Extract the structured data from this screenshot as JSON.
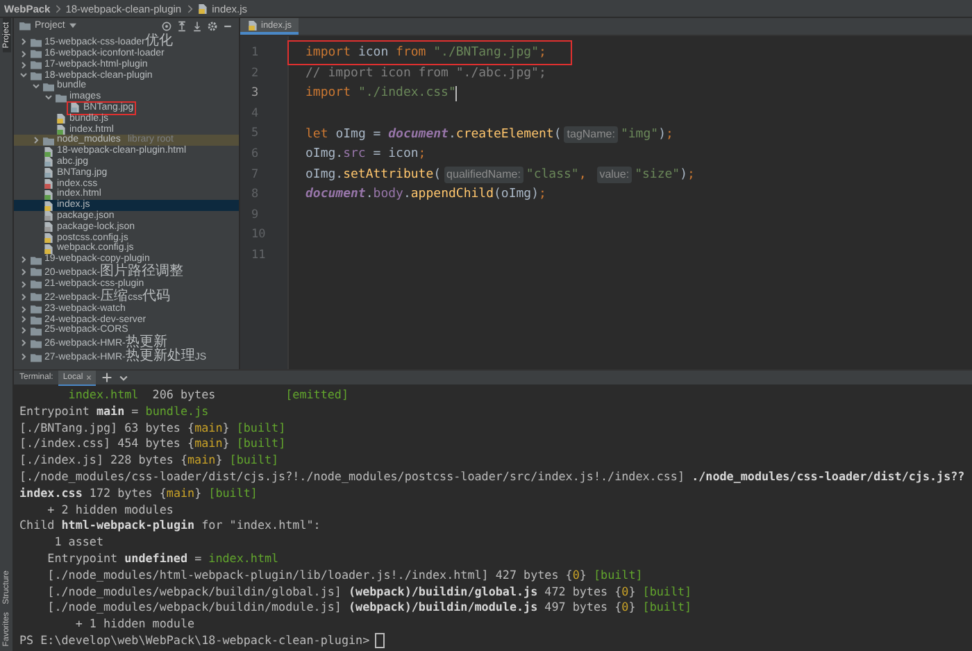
{
  "breadcrumbs": [
    {
      "label": "WebPack",
      "kind": "folder"
    },
    {
      "label": "18-webpack-clean-plugin",
      "kind": "folder"
    },
    {
      "label": "index.js",
      "kind": "js"
    }
  ],
  "tool_strip": [
    {
      "label": "Project",
      "selected": true
    },
    {
      "label": "Structure",
      "selected": false
    },
    {
      "label": "Favorites",
      "selected": false
    }
  ],
  "project_panel": {
    "title": "Project",
    "tree": [
      {
        "name": "15-webpack-css-loader优化",
        "kind": "folder",
        "expanded": false,
        "selected": false
      },
      {
        "name": "16-webpack-iconfont-loader",
        "kind": "folder",
        "expanded": false,
        "selected": false
      },
      {
        "name": "17-webpack-html-plugin",
        "kind": "folder",
        "expanded": false,
        "selected": false
      },
      {
        "name": "18-webpack-clean-plugin",
        "kind": "folder",
        "expanded": true,
        "selected": false,
        "children": [
          {
            "name": "bundle",
            "kind": "folder",
            "expanded": true,
            "selected": false,
            "children": [
              {
                "name": "images",
                "kind": "folder",
                "expanded": true,
                "selected": false,
                "children": [
                  {
                    "name": "BNTang.jpg",
                    "kind": "image",
                    "selected": false,
                    "boxed": true
                  }
                ]
              },
              {
                "name": "bundle.js",
                "kind": "js",
                "selected": false
              },
              {
                "name": "index.html",
                "kind": "html",
                "selected": false
              }
            ]
          },
          {
            "name": "node_modules",
            "note": "library root",
            "kind": "folder",
            "expanded": false,
            "selected": false,
            "library": true
          },
          {
            "name": "18-webpack-clean-plugin.html",
            "kind": "html",
            "selected": false
          },
          {
            "name": "abc.jpg",
            "kind": "image",
            "selected": false
          },
          {
            "name": "BNTang.jpg",
            "kind": "image",
            "selected": false
          },
          {
            "name": "index.css",
            "kind": "css",
            "selected": false
          },
          {
            "name": "index.html",
            "kind": "html",
            "selected": false
          },
          {
            "name": "index.js",
            "kind": "js",
            "selected": true
          },
          {
            "name": "package.json",
            "kind": "json",
            "selected": false
          },
          {
            "name": "package-lock.json",
            "kind": "json",
            "selected": false
          },
          {
            "name": "postcss.config.js",
            "kind": "js",
            "selected": false
          },
          {
            "name": "webpack.config.js",
            "kind": "js",
            "selected": false
          }
        ]
      },
      {
        "name": "19-webpack-copy-plugin",
        "kind": "folder",
        "expanded": false,
        "selected": false
      },
      {
        "name": "20-webpack-图片路径调整",
        "kind": "folder",
        "expanded": false,
        "selected": false
      },
      {
        "name": "21-webpack-css-plugin",
        "kind": "folder",
        "expanded": false,
        "selected": false
      },
      {
        "name": "22-webpack-压缩css代码",
        "kind": "folder",
        "expanded": false,
        "selected": false
      },
      {
        "name": "23-webpack-watch",
        "kind": "folder",
        "expanded": false,
        "selected": false
      },
      {
        "name": "24-webpack-dev-server",
        "kind": "folder",
        "expanded": false,
        "selected": false
      },
      {
        "name": "25-webpack-CORS",
        "kind": "folder",
        "expanded": false,
        "selected": false
      },
      {
        "name": "26-webpack-HMR-热更新",
        "kind": "folder",
        "expanded": false,
        "selected": false
      },
      {
        "name": "27-webpack-HMR-热更新处理JS",
        "kind": "folder",
        "expanded": false,
        "selected": false
      }
    ]
  },
  "editor": {
    "tab": "index.js",
    "lines": [
      {
        "number": "1",
        "boxed": true,
        "current": false,
        "tokens": [
          {
            "kind": "kw",
            "text": "import "
          },
          {
            "kind": "id",
            "text": "icon "
          },
          {
            "kind": "kw",
            "text": "from "
          },
          {
            "kind": "str",
            "text": "\"./BNTang.jpg\""
          },
          {
            "kind": "kw",
            "text": ";"
          }
        ]
      },
      {
        "number": "2",
        "boxed": false,
        "current": false,
        "tokens": [
          {
            "kind": "cmt",
            "text": "// import icon from \"./abc.jpg\";"
          }
        ]
      },
      {
        "number": "3",
        "boxed": false,
        "current": true,
        "tokens": [
          {
            "kind": "kw",
            "text": "import "
          },
          {
            "kind": "str",
            "text": "\"./index.css\""
          }
        ]
      },
      {
        "number": "4",
        "boxed": false,
        "current": false
      },
      {
        "number": "5",
        "boxed": false,
        "current": false,
        "tokens": [
          {
            "kind": "kw",
            "text": "let "
          },
          {
            "kind": "id",
            "text": "oImg = "
          },
          {
            "kind": "glob",
            "text": "document"
          },
          {
            "kind": "id",
            "text": "."
          },
          {
            "kind": "fn",
            "text": "createElement"
          },
          {
            "kind": "id",
            "text": "("
          },
          {
            "kind": "hint",
            "text": "tagName:"
          },
          {
            "kind": "str",
            "text": "\"img\""
          },
          {
            "kind": "id",
            "text": ")"
          },
          {
            "kind": "kw",
            "text": ";"
          }
        ]
      },
      {
        "number": "6",
        "boxed": false,
        "current": false,
        "tokens": [
          {
            "kind": "id",
            "text": "oImg."
          },
          {
            "kind": "field",
            "text": "src"
          },
          {
            "kind": "id",
            "text": " = icon"
          },
          {
            "kind": "kw",
            "text": ";"
          }
        ]
      },
      {
        "number": "7",
        "boxed": false,
        "current": false,
        "tokens": [
          {
            "kind": "id",
            "text": "oImg."
          },
          {
            "kind": "fn",
            "text": "setAttribute"
          },
          {
            "kind": "id",
            "text": "("
          },
          {
            "kind": "hint",
            "text": "qualifiedName:"
          },
          {
            "kind": "str",
            "text": "\"class\""
          },
          {
            "kind": "kw",
            "text": ", "
          },
          {
            "kind": "hint",
            "text": "value:"
          },
          {
            "kind": "str",
            "text": "\"size\""
          },
          {
            "kind": "id",
            "text": ")"
          },
          {
            "kind": "kw",
            "text": ";"
          }
        ]
      },
      {
        "number": "8",
        "boxed": false,
        "current": false,
        "tokens": [
          {
            "kind": "glob",
            "text": "document"
          },
          {
            "kind": "id",
            "text": "."
          },
          {
            "kind": "field",
            "text": "body"
          },
          {
            "kind": "id",
            "text": "."
          },
          {
            "kind": "fn",
            "text": "appendChild"
          },
          {
            "kind": "id",
            "text": "(oImg)"
          },
          {
            "kind": "kw",
            "text": ";"
          }
        ]
      },
      {
        "number": "9",
        "boxed": false,
        "current": false
      },
      {
        "number": "10",
        "boxed": false,
        "current": false
      },
      {
        "number": "11",
        "boxed": false,
        "current": false
      }
    ]
  },
  "terminal": {
    "title": "Terminal:",
    "tabs": [
      {
        "label": "Local",
        "selected": true
      }
    ],
    "lines": [
      {
        "kind": "output",
        "segments": [
          {
            "kind": "green",
            "text": "       index.html"
          },
          {
            "kind": "plain",
            "text": "  206 bytes          "
          },
          {
            "kind": "green",
            "text": "[emitted]"
          }
        ]
      },
      {
        "kind": "output",
        "segments": [
          {
            "kind": "plain",
            "text": "Entrypoint "
          },
          {
            "kind": "bold",
            "text": "main"
          },
          {
            "kind": "plain",
            "text": " = "
          },
          {
            "kind": "green",
            "text": "bundle.js"
          }
        ]
      },
      {
        "kind": "output",
        "segments": [
          {
            "kind": "plain",
            "text": "[./BNTang.jpg] 63 bytes {"
          },
          {
            "kind": "yellow",
            "text": "main"
          },
          {
            "kind": "plain",
            "text": "} "
          },
          {
            "kind": "green",
            "text": "[built]"
          }
        ]
      },
      {
        "kind": "output",
        "segments": [
          {
            "kind": "plain",
            "text": "[./index.css] 454 bytes {"
          },
          {
            "kind": "yellow",
            "text": "main"
          },
          {
            "kind": "plain",
            "text": "} "
          },
          {
            "kind": "green",
            "text": "[built]"
          }
        ]
      },
      {
        "kind": "output",
        "segments": [
          {
            "kind": "plain",
            "text": "[./index.js] 228 bytes {"
          },
          {
            "kind": "yellow",
            "text": "main"
          },
          {
            "kind": "plain",
            "text": "} "
          },
          {
            "kind": "green",
            "text": "[built]"
          }
        ]
      },
      {
        "kind": "output",
        "segments": [
          {
            "kind": "plain",
            "text": "[./node_modules/css-loader/dist/cjs.js?!./node_modules/postcss-loader/src/index.js!./index.css] "
          },
          {
            "kind": "bold",
            "text": "./node_modules/css-loader/dist/cjs.js??"
          }
        ]
      },
      {
        "kind": "output",
        "segments": [
          {
            "kind": "bold",
            "text": "index.css"
          },
          {
            "kind": "plain",
            "text": " 172 bytes {"
          },
          {
            "kind": "yellow",
            "text": "main"
          },
          {
            "kind": "plain",
            "text": "} "
          },
          {
            "kind": "green",
            "text": "[built]"
          }
        ]
      },
      {
        "kind": "output",
        "segments": [
          {
            "kind": "plain",
            "text": "    + 2 hidden modules"
          }
        ]
      },
      {
        "kind": "output",
        "segments": [
          {
            "kind": "plain",
            "text": "Child "
          },
          {
            "kind": "bold",
            "text": "html-webpack-plugin"
          },
          {
            "kind": "plain",
            "text": " for \"index.html\":"
          }
        ]
      },
      {
        "kind": "output",
        "segments": [
          {
            "kind": "plain",
            "text": "     1 asset"
          }
        ]
      },
      {
        "kind": "output",
        "segments": [
          {
            "kind": "plain",
            "text": "    Entrypoint "
          },
          {
            "kind": "bold",
            "text": "undefined"
          },
          {
            "kind": "plain",
            "text": " = "
          },
          {
            "kind": "green",
            "text": "index.html"
          }
        ]
      },
      {
        "kind": "output",
        "segments": [
          {
            "kind": "plain",
            "text": "    [./node_modules/html-webpack-plugin/lib/loader.js!./index.html] 427 bytes {"
          },
          {
            "kind": "yellow",
            "text": "0"
          },
          {
            "kind": "plain",
            "text": "} "
          },
          {
            "kind": "green",
            "text": "[built]"
          }
        ]
      },
      {
        "kind": "output",
        "segments": [
          {
            "kind": "plain",
            "text": "    [./node_modules/webpack/buildin/global.js] "
          },
          {
            "kind": "bold",
            "text": "(webpack)/buildin/global.js"
          },
          {
            "kind": "plain",
            "text": " 472 bytes {"
          },
          {
            "kind": "yellow",
            "text": "0"
          },
          {
            "kind": "plain",
            "text": "} "
          },
          {
            "kind": "green",
            "text": "[built]"
          }
        ]
      },
      {
        "kind": "output",
        "segments": [
          {
            "kind": "plain",
            "text": "    [./node_modules/webpack/buildin/module.js] "
          },
          {
            "kind": "bold",
            "text": "(webpack)/buildin/module.js"
          },
          {
            "kind": "plain",
            "text": " 497 bytes {"
          },
          {
            "kind": "yellow",
            "text": "0"
          },
          {
            "kind": "plain",
            "text": "} "
          },
          {
            "kind": "green",
            "text": "[built]"
          }
        ]
      },
      {
        "kind": "output",
        "segments": [
          {
            "kind": "plain",
            "text": "        + 1 hidden module"
          }
        ]
      },
      {
        "kind": "prompt",
        "segments": [
          {
            "kind": "plain",
            "text": "PS E:\\develop\\web\\WebPack\\18-webpack-clean-plugin>"
          }
        ]
      }
    ]
  }
}
